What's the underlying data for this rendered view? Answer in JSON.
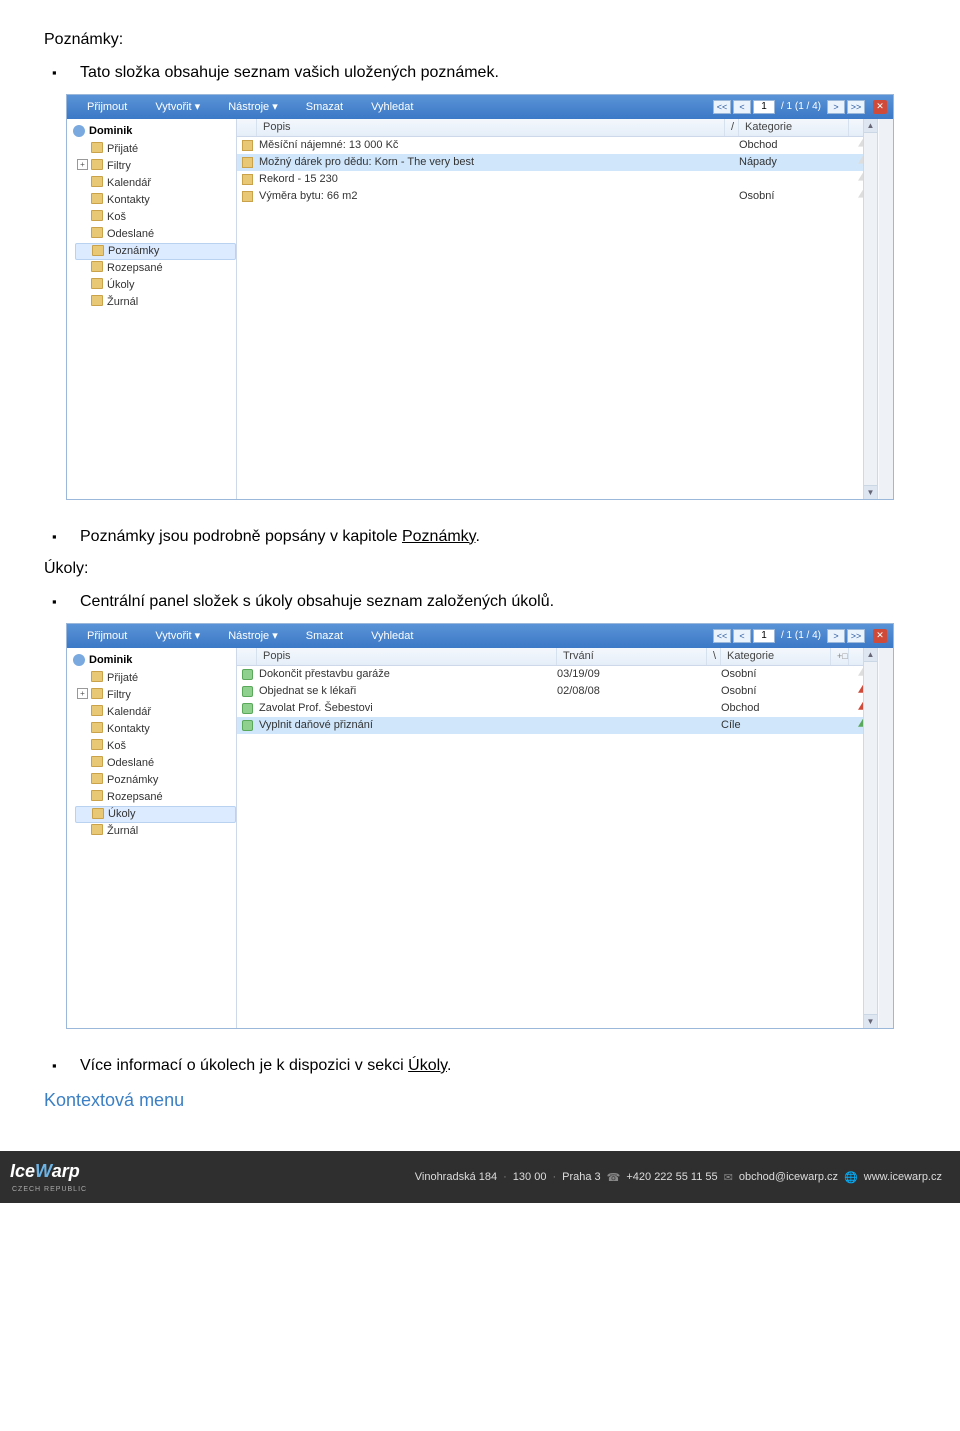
{
  "doc": {
    "heading1": "Poznámky:",
    "bullet1": "Tato složka obsahuje seznam vašich uložených poznámek.",
    "bullet2a": "Poznámky jsou podrobně popsány v kapitole ",
    "bullet2_link": "Poznámky",
    "bullet2b": ".",
    "heading2": "Úkoly:",
    "bullet3": "Centrální panel složek s úkoly obsahuje seznam založených úkolů.",
    "bullet4a": "Více informací o úkolech je k dispozici v sekci ",
    "bullet4_link": "Úkoly",
    "bullet4b": ".",
    "context_heading": "Kontextová menu"
  },
  "menu": {
    "prijmout": "Přijmout",
    "vytvorit": "Vytvořit",
    "nastroje": "Nástroje",
    "smazat": "Smazat",
    "vyhledat": "Vyhledat",
    "caret": "▾"
  },
  "pager": {
    "first": "<<",
    "prev": "<",
    "page": "1",
    "info": "/ 1  (1 / 4)",
    "next": ">",
    "last": ">>",
    "close": "✕"
  },
  "sidebar": {
    "account": "Dominik",
    "folders": [
      "Přijaté",
      "Filtry",
      "Kalendář",
      "Kontakty",
      "Koš",
      "Odeslané",
      "Poznámky",
      "Rozepsané",
      "Úkoly",
      "Žurnál"
    ]
  },
  "notes": {
    "cols": {
      "popis": "Popis",
      "kategorie": "Kategorie",
      "sort": "/"
    },
    "rows": [
      {
        "popis": "Měsíční nájemné: 13 000 Kč",
        "kategorie": "Obchod",
        "flag": "white"
      },
      {
        "popis": "Možný dárek pro dědu: Korn - The very best",
        "kategorie": "Nápady",
        "flag": "white",
        "sel": true
      },
      {
        "popis": "Rekord - 15 230",
        "kategorie": "",
        "flag": "white"
      },
      {
        "popis": "Výměra bytu: 66 m2",
        "kategorie": "Osobní",
        "flag": "white"
      }
    ]
  },
  "tasks": {
    "cols": {
      "popis": "Popis",
      "trvani": "Trvání",
      "kategorie": "Kategorie",
      "sort": "\\"
    },
    "rows": [
      {
        "popis": "Dokončit přestavbu garáže",
        "trvani": "03/19/09",
        "kategorie": "Osobní",
        "flag": "white"
      },
      {
        "popis": "Objednat se k lékaři",
        "trvani": "02/08/08",
        "kategorie": "Osobní",
        "flag": "red"
      },
      {
        "popis": "Zavolat Prof. Šebestovi",
        "trvani": "",
        "kategorie": "Obchod",
        "flag": "red"
      },
      {
        "popis": "Vyplnit daňové přiznání",
        "trvani": "",
        "kategorie": "Cíle",
        "flag": "green",
        "sel": true
      }
    ]
  },
  "footer": {
    "brand1": "Ice",
    "brand2": "W",
    "brand3": "arp",
    "sub": "CZECH  REPUBLIC",
    "addr": "Vinohradská 184",
    "addr2": "130 00",
    "addr3": "Praha 3",
    "phone": "+420 222 55 11 55",
    "email": "obchod@icewarp.cz",
    "web": "www.icewarp.cz"
  }
}
